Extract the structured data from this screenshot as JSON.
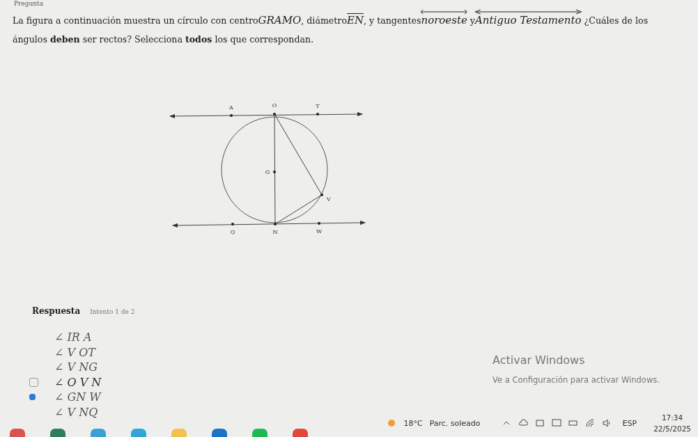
{
  "header": {
    "title": "Pregunta"
  },
  "question": [
    {
      "kind": "text",
      "text": "La figura a continuación muestra un círculo con centro"
    },
    {
      "kind": "math",
      "text": "GRAMO"
    },
    {
      "kind": "text",
      "text": ", diámetro"
    },
    {
      "kind": "segment",
      "text": "EN"
    },
    {
      "kind": "text",
      "text": ", y tangentes"
    },
    {
      "kind": "line",
      "text": "noroeste"
    },
    {
      "kind": "text",
      "text": " y"
    },
    {
      "kind": "line",
      "text": "Antiguo Testamento"
    },
    {
      "kind": "text",
      "text": " ¿Cuáles de los ángulos **deben** ser rectos? Selecciona **todos** los que correspondan."
    }
  ],
  "figure": {
    "labels": [
      "A",
      "O",
      "T",
      "G",
      "V",
      "Q",
      "N",
      "W"
    ]
  },
  "answer": {
    "title": "Respuesta",
    "attempt": "Intento 1 de 2",
    "options": [
      {
        "label": "∠ IR A",
        "checked": false,
        "hovered": false
      },
      {
        "label": "∠ V OT",
        "checked": false,
        "hovered": false
      },
      {
        "label": "∠ V NG",
        "checked": false,
        "hovered": false
      },
      {
        "label": "∠ O V N",
        "checked": false,
        "hovered": true
      },
      {
        "label": "∠ GN W",
        "checked": true,
        "hovered": false
      },
      {
        "label": "∠ V NQ",
        "checked": false,
        "hovered": false
      }
    ]
  },
  "activation": {
    "title": "Activar Windows",
    "subtitle": "Ve a Configuración para activar Windows."
  },
  "taskbar": {
    "apps": [
      {
        "color": "#d9534f"
      },
      {
        "color": "#2e7d5b"
      },
      {
        "color": "#3aa0d8"
      },
      {
        "color": "#2fa6d6"
      },
      {
        "color": "#f2c14e"
      },
      {
        "color": "#1a73c9"
      },
      {
        "color": "#1db954"
      },
      {
        "color": "#e0483c"
      }
    ],
    "weather": {
      "temperature": "18°C",
      "condition": "Parc. soleado"
    },
    "language": "ESP",
    "time": "17:34",
    "date": "22/5/2025"
  }
}
